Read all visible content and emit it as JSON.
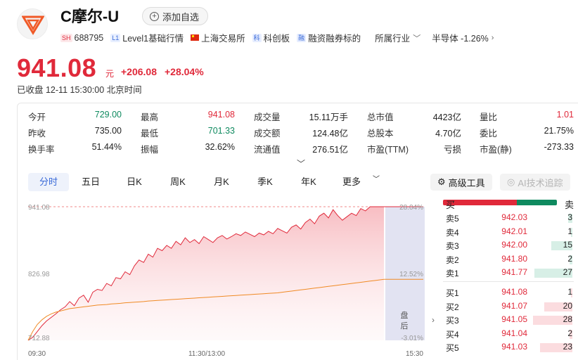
{
  "header": {
    "name": "C摩尔-U",
    "watch_label": "添加自选",
    "exchange_badge": "SH",
    "code": "688795",
    "level_badge": "L1",
    "level_label": "Level1基础行情",
    "market_label": "上海交易所",
    "board_badge": "科",
    "board_label": "科创板",
    "margin_badge": "融",
    "margin_label": "融资融券标的",
    "industry_label": "所属行业",
    "sector_label": "半导体 -1.26%"
  },
  "quote": {
    "price": "941.08",
    "unit": "元",
    "change": "+206.08",
    "change_pct": "+28.04%",
    "status": "已收盘 12-11 15:30:00 北京时间"
  },
  "stats": [
    [
      {
        "label": "今开",
        "value": "729.00",
        "color": "green"
      },
      {
        "label": "最高",
        "value": "941.08",
        "color": "red"
      },
      {
        "label": "成交量",
        "value": "15.11万手",
        "color": "dark"
      },
      {
        "label": "总市值",
        "value": "4423亿",
        "color": "dark"
      },
      {
        "label": "量比",
        "value": "1.01",
        "color": "red"
      }
    ],
    [
      {
        "label": "昨收",
        "value": "735.00",
        "color": "dark"
      },
      {
        "label": "最低",
        "value": "701.33",
        "color": "green"
      },
      {
        "label": "成交额",
        "value": "124.48亿",
        "color": "dark"
      },
      {
        "label": "总股本",
        "value": "4.70亿",
        "color": "dark"
      },
      {
        "label": "委比",
        "value": "21.75%",
        "color": "dark"
      }
    ],
    [
      {
        "label": "换手率",
        "value": "51.44%",
        "color": "dark"
      },
      {
        "label": "振幅",
        "value": "32.62%",
        "color": "dark"
      },
      {
        "label": "流通值",
        "value": "276.51亿",
        "color": "dark"
      },
      {
        "label": "市盈(TTM)",
        "value": "亏损",
        "color": "dark"
      },
      {
        "label": "市盈(静)",
        "value": "-273.33",
        "color": "dark"
      }
    ]
  ],
  "tabs": [
    "分时",
    "五日",
    "日K",
    "周K",
    "月K",
    "季K",
    "年K",
    "更多"
  ],
  "tools": {
    "advanced": "高级工具",
    "ai": "AI技术追踪"
  },
  "chart_data": {
    "type": "line",
    "y_labels_left": [
      "941.08",
      "826.98",
      "712.88"
    ],
    "y_labels_right": [
      "28.04%",
      "12.52%",
      "-3.01%"
    ],
    "x_labels": [
      "09:30",
      "11:30/13:00",
      "15:30"
    ],
    "overlay_label": "盘后",
    "ylim": [
      712.88,
      941.08
    ],
    "price_series": [
      712.9,
      718,
      728,
      738,
      746,
      752,
      758,
      765,
      770,
      779,
      772,
      785,
      790,
      778,
      795,
      800,
      798,
      810,
      806,
      820,
      818,
      830,
      825,
      840,
      850,
      846,
      860,
      855,
      870,
      866,
      875,
      870,
      882,
      876,
      888,
      880,
      885,
      878,
      890,
      885,
      880,
      888,
      892,
      886,
      890,
      895,
      892,
      898,
      894,
      890,
      896,
      893,
      899,
      895,
      904,
      900,
      896,
      906,
      910,
      903,
      914,
      920,
      912,
      925,
      930,
      922,
      936,
      926,
      918,
      924,
      930,
      926,
      938,
      934,
      941.08,
      941.08,
      941.08,
      941.08
    ],
    "avg_series": [
      712.9,
      728,
      740,
      748,
      754,
      758,
      761,
      763,
      765,
      767,
      768,
      769,
      770,
      771,
      772,
      773,
      773.5,
      774,
      775,
      775.5,
      776,
      777,
      777.5,
      778,
      778.5,
      779,
      780,
      780.5,
      781,
      781.5,
      782,
      782.5,
      783,
      783.5,
      784,
      784.5,
      785,
      785.5,
      786,
      786.5,
      787,
      787.5,
      788,
      788.5,
      789,
      789.5,
      790,
      790.5,
      791,
      791.5,
      792,
      792.5,
      793,
      793.5,
      794,
      795,
      796,
      797,
      798,
      799,
      800,
      801,
      802,
      803,
      804,
      805,
      806,
      807,
      808,
      809,
      810,
      811,
      812,
      813,
      814,
      815,
      816,
      817
    ]
  },
  "order_book": {
    "header_sell": "卖",
    "header_buy": "买",
    "asks": [
      {
        "name": "卖5",
        "price": "942.03",
        "volume": "3"
      },
      {
        "name": "卖4",
        "price": "942.01",
        "volume": "1"
      },
      {
        "name": "卖3",
        "price": "942.00",
        "volume": "15"
      },
      {
        "name": "卖2",
        "price": "941.80",
        "volume": "2"
      },
      {
        "name": "卖1",
        "price": "941.77",
        "volume": "27"
      }
    ],
    "bids": [
      {
        "name": "买1",
        "price": "941.08",
        "volume": "1"
      },
      {
        "name": "买2",
        "price": "941.07",
        "volume": "20"
      },
      {
        "name": "买3",
        "price": "941.05",
        "volume": "28"
      },
      {
        "name": "买4",
        "price": "941.04",
        "volume": "2"
      },
      {
        "name": "买5",
        "price": "941.03",
        "volume": "23"
      }
    ],
    "buy_ratio": 0.64,
    "max_volume": 28
  },
  "colors": {
    "up": "#e0293a",
    "down": "#0f8a5f",
    "avg": "#f08a24",
    "accent": "#3a6ad8"
  }
}
